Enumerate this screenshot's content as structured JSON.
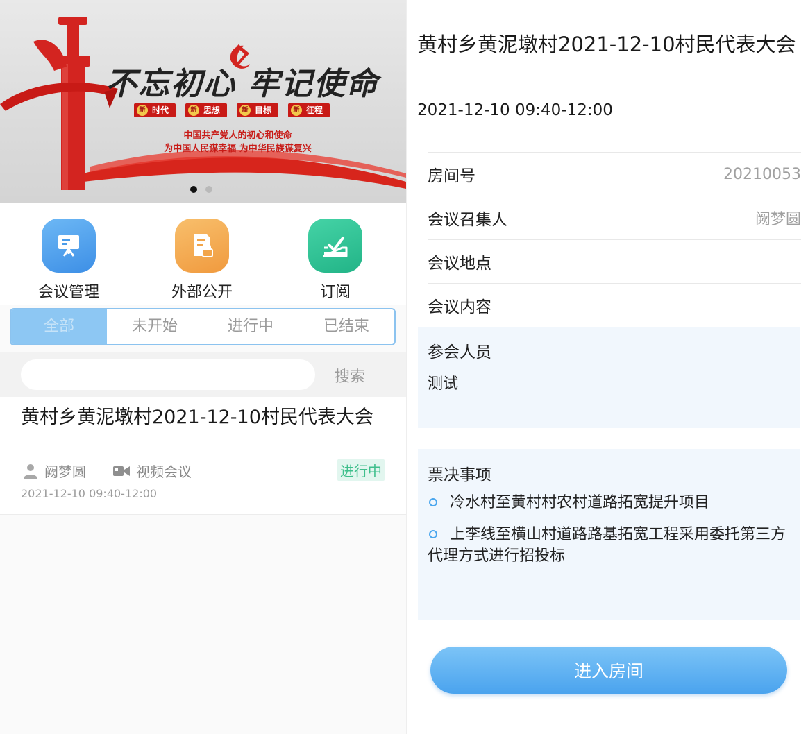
{
  "banner": {
    "slogan": "不忘初心 牢记使命",
    "tags": [
      "时代",
      "思想",
      "目标",
      "征程"
    ],
    "tag_icon": "新",
    "line1": "中国共产党人的初心和使命",
    "line2": "为中国人民谋幸福 为中华民族谋复兴",
    "carousel_active": 1,
    "carousel_count": 2
  },
  "quick_actions": [
    {
      "label": "会议管理",
      "icon": "presentation-board-icon",
      "color": "#4aa3ee"
    },
    {
      "label": "外部公开",
      "icon": "document-lock-icon",
      "color": "#f4a04a"
    },
    {
      "label": "订阅",
      "icon": "ballot-check-icon",
      "color": "#2fc59a"
    }
  ],
  "tabs": [
    "全部",
    "未开始",
    "进行中",
    "已结束"
  ],
  "search": {
    "placeholder": "",
    "button": "搜索"
  },
  "meeting_card": {
    "title": "黄村乡黄泥墩村2021-12-10村民代表大会",
    "organizer": "阙梦圆",
    "type": "视频会议",
    "status": "进行中",
    "time": "2021-12-10 09:40-12:00"
  },
  "detail": {
    "title": "黄村乡黄泥墩村2021-12-10村民代表大会",
    "time": "2021-12-10 09:40-12:00",
    "rows": [
      {
        "label": "房间号",
        "value": "20210053"
      },
      {
        "label": "会议召集人",
        "value": "阙梦圆"
      },
      {
        "label": "会议地点",
        "value": ""
      },
      {
        "label": "会议内容",
        "value": ""
      }
    ],
    "attendees_label": "参会人员",
    "attendees_value": "测试",
    "votes_label": "票决事项",
    "votes": [
      "冷水村至黄村村农村道路拓宽提升项目",
      "上李线至横山村道路路基拓宽工程采用委托第三方代理方式进行招投标"
    ],
    "enter_button": "进入房间"
  }
}
